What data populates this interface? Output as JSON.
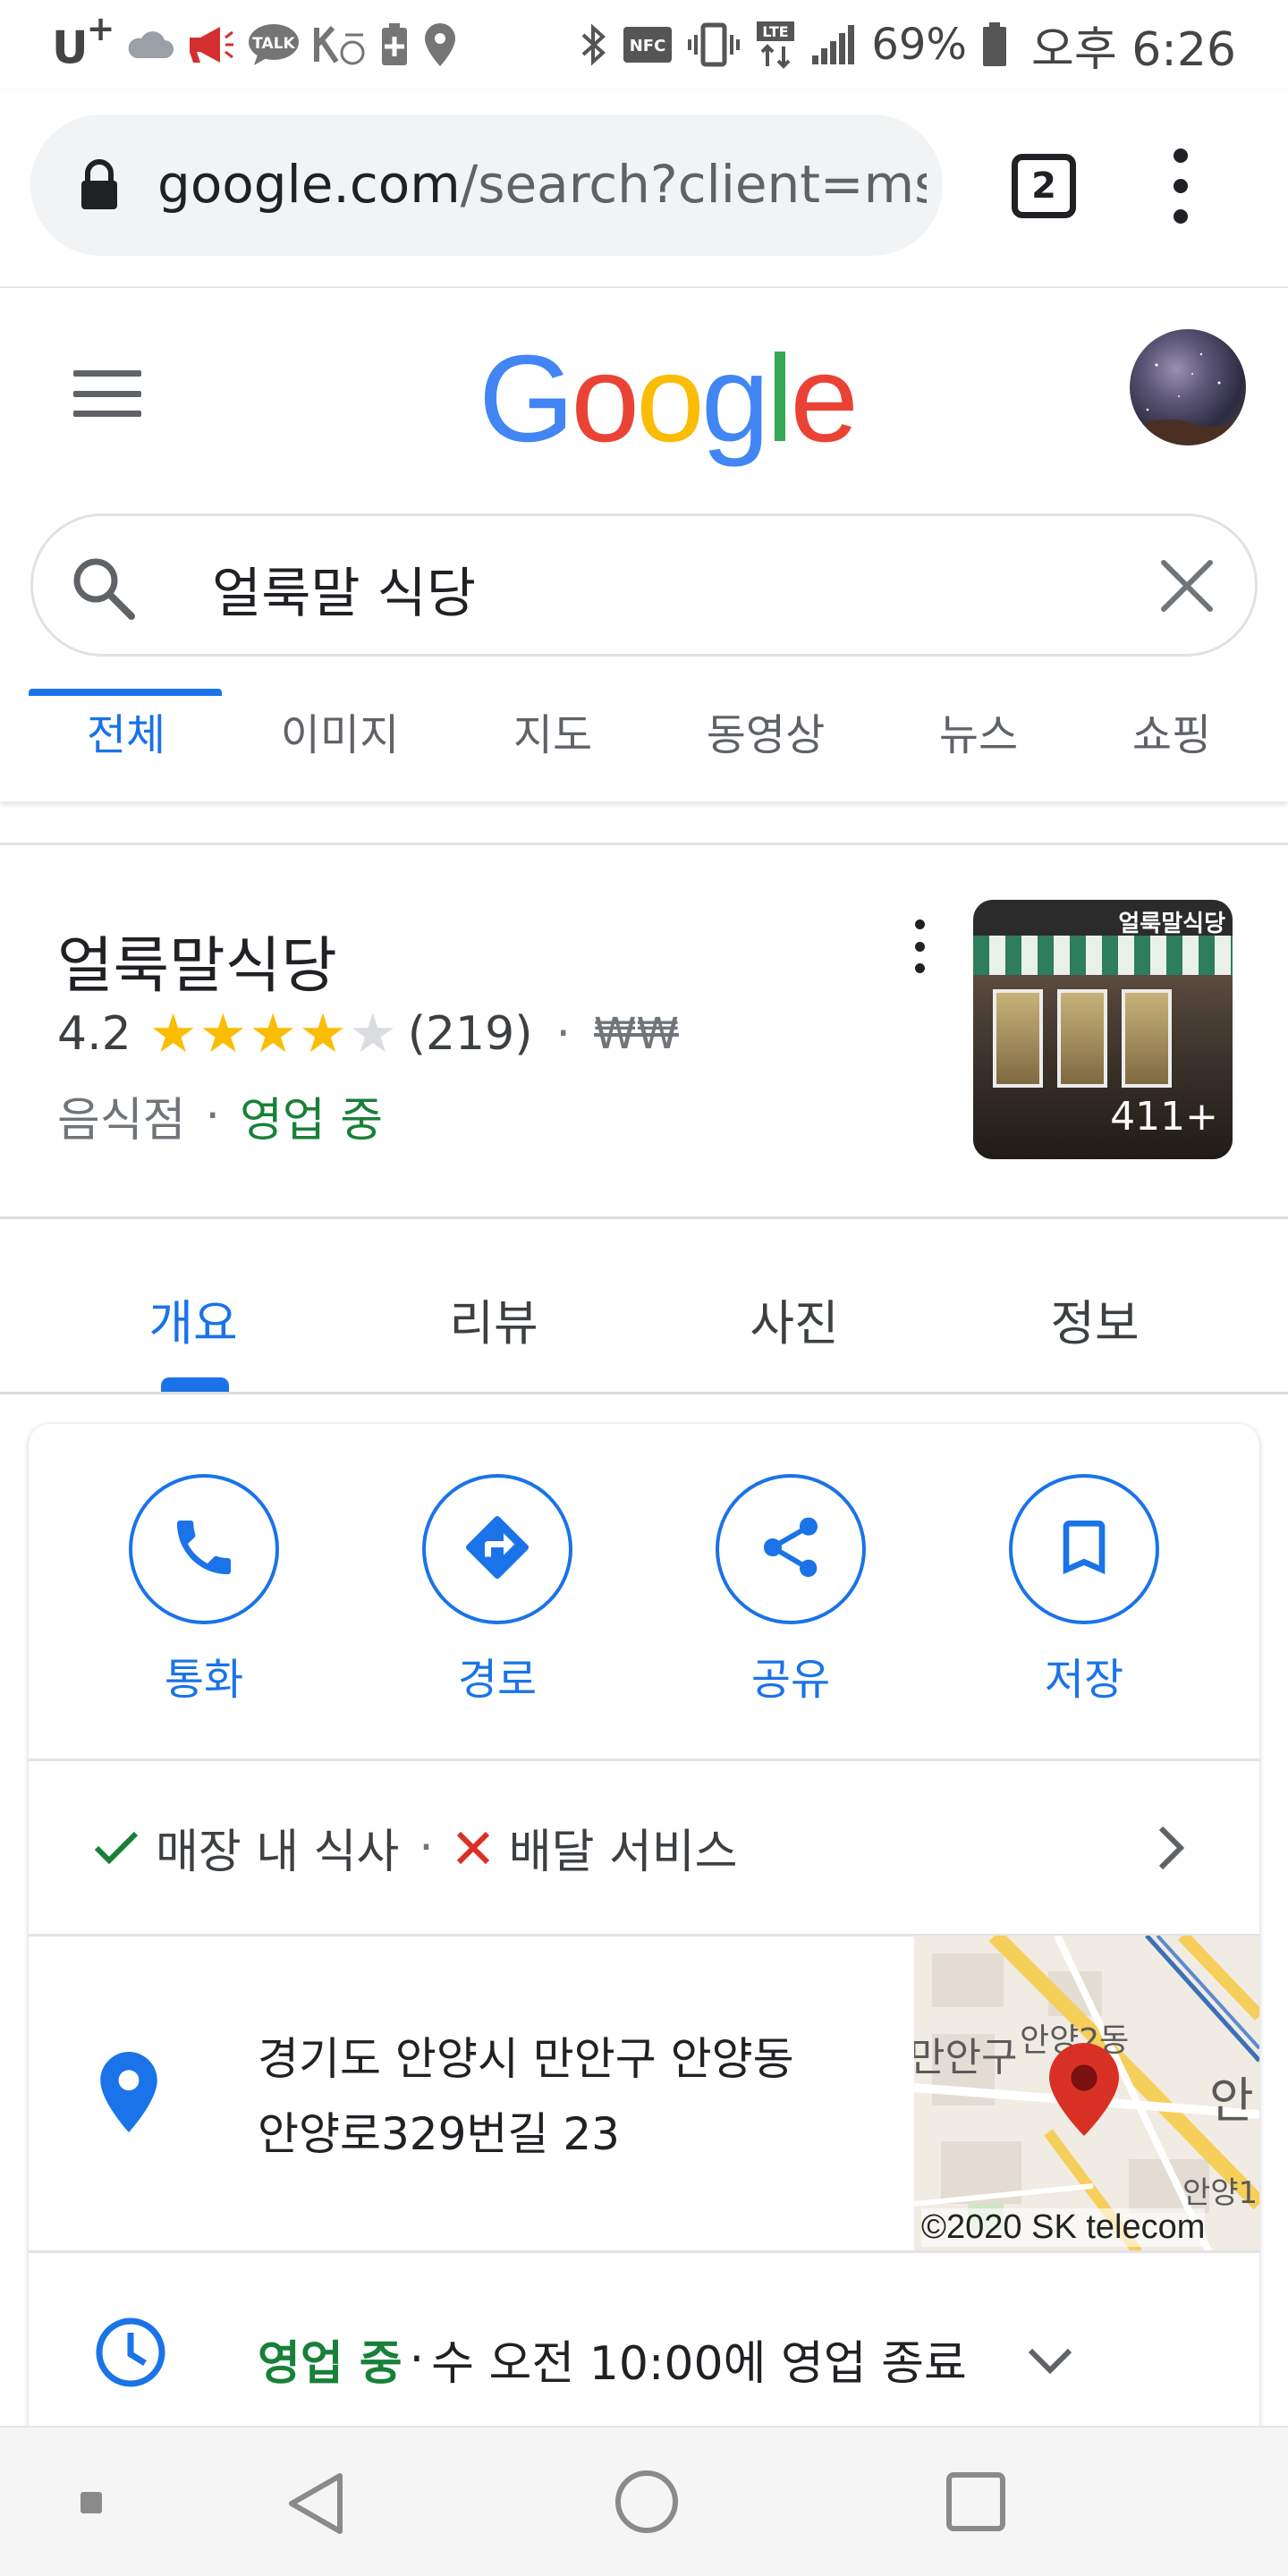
{
  "status_bar": {
    "carrier": "U",
    "carrier_plus": "+",
    "talk_badge": "TALK",
    "nfc_badge": "NFC",
    "lte_badge": "LTE",
    "battery_percent": "69%",
    "time": "오후 6:26",
    "icons": [
      "cloud-icon",
      "megaphone-icon",
      "talk-icon",
      "mute-icon",
      "battery-saver-icon",
      "location-icon",
      "bluetooth-icon",
      "nfc-icon",
      "vibrate-icon",
      "lte-icon",
      "signal-icon",
      "battery-icon"
    ]
  },
  "browser": {
    "url_host": "google.com",
    "url_path": "/search?client=ms",
    "tab_count": "2"
  },
  "search": {
    "logo_letters": [
      "G",
      "o",
      "o",
      "g",
      "l",
      "e"
    ],
    "logo_colors": [
      "#4285F4",
      "#EA4335",
      "#FBBC05",
      "#4285F4",
      "#34A853",
      "#EA4335"
    ],
    "query": "얼룩말 식당",
    "tabs": [
      "전체",
      "이미지",
      "지도",
      "동영상",
      "뉴스",
      "쇼핑"
    ],
    "active_tab": "전체"
  },
  "place": {
    "name": "얼룩말식당",
    "rating": "4.2",
    "stars_filled": 4,
    "stars_total": 5,
    "review_count": "(219)",
    "dot": "·",
    "price": "₩₩",
    "category": "음식점",
    "status": "영업 중",
    "photo_label": "얼룩말식당",
    "photo_count": "411+",
    "detail_tabs": [
      "개요",
      "리뷰",
      "사진",
      "정보"
    ],
    "active_detail_tab": "개요"
  },
  "actions": [
    {
      "label": "통화",
      "icon": "phone-icon"
    },
    {
      "label": "경로",
      "icon": "directions-icon"
    },
    {
      "label": "공유",
      "icon": "share-icon"
    },
    {
      "label": "저장",
      "icon": "bookmark-icon"
    }
  ],
  "services": {
    "dine_in": "매장 내 식사",
    "separator": "·",
    "delivery": "배달 서비스"
  },
  "address": {
    "line1": "경기도 안양시 만안구 안양동",
    "line2": "안양로329번길 23",
    "map_labels": [
      "만안구",
      "안양2동",
      "안",
      "안양1"
    ],
    "map_copyright": "©2020 SK telecom"
  },
  "hours": {
    "status": "영업 중",
    "dot": "·",
    "detail": "수 오전 10:00에 영업 종료"
  },
  "colors": {
    "accent": "#1a73e8",
    "open_green": "#188038",
    "star": "#fbbc04",
    "closed_red": "#d93025"
  }
}
